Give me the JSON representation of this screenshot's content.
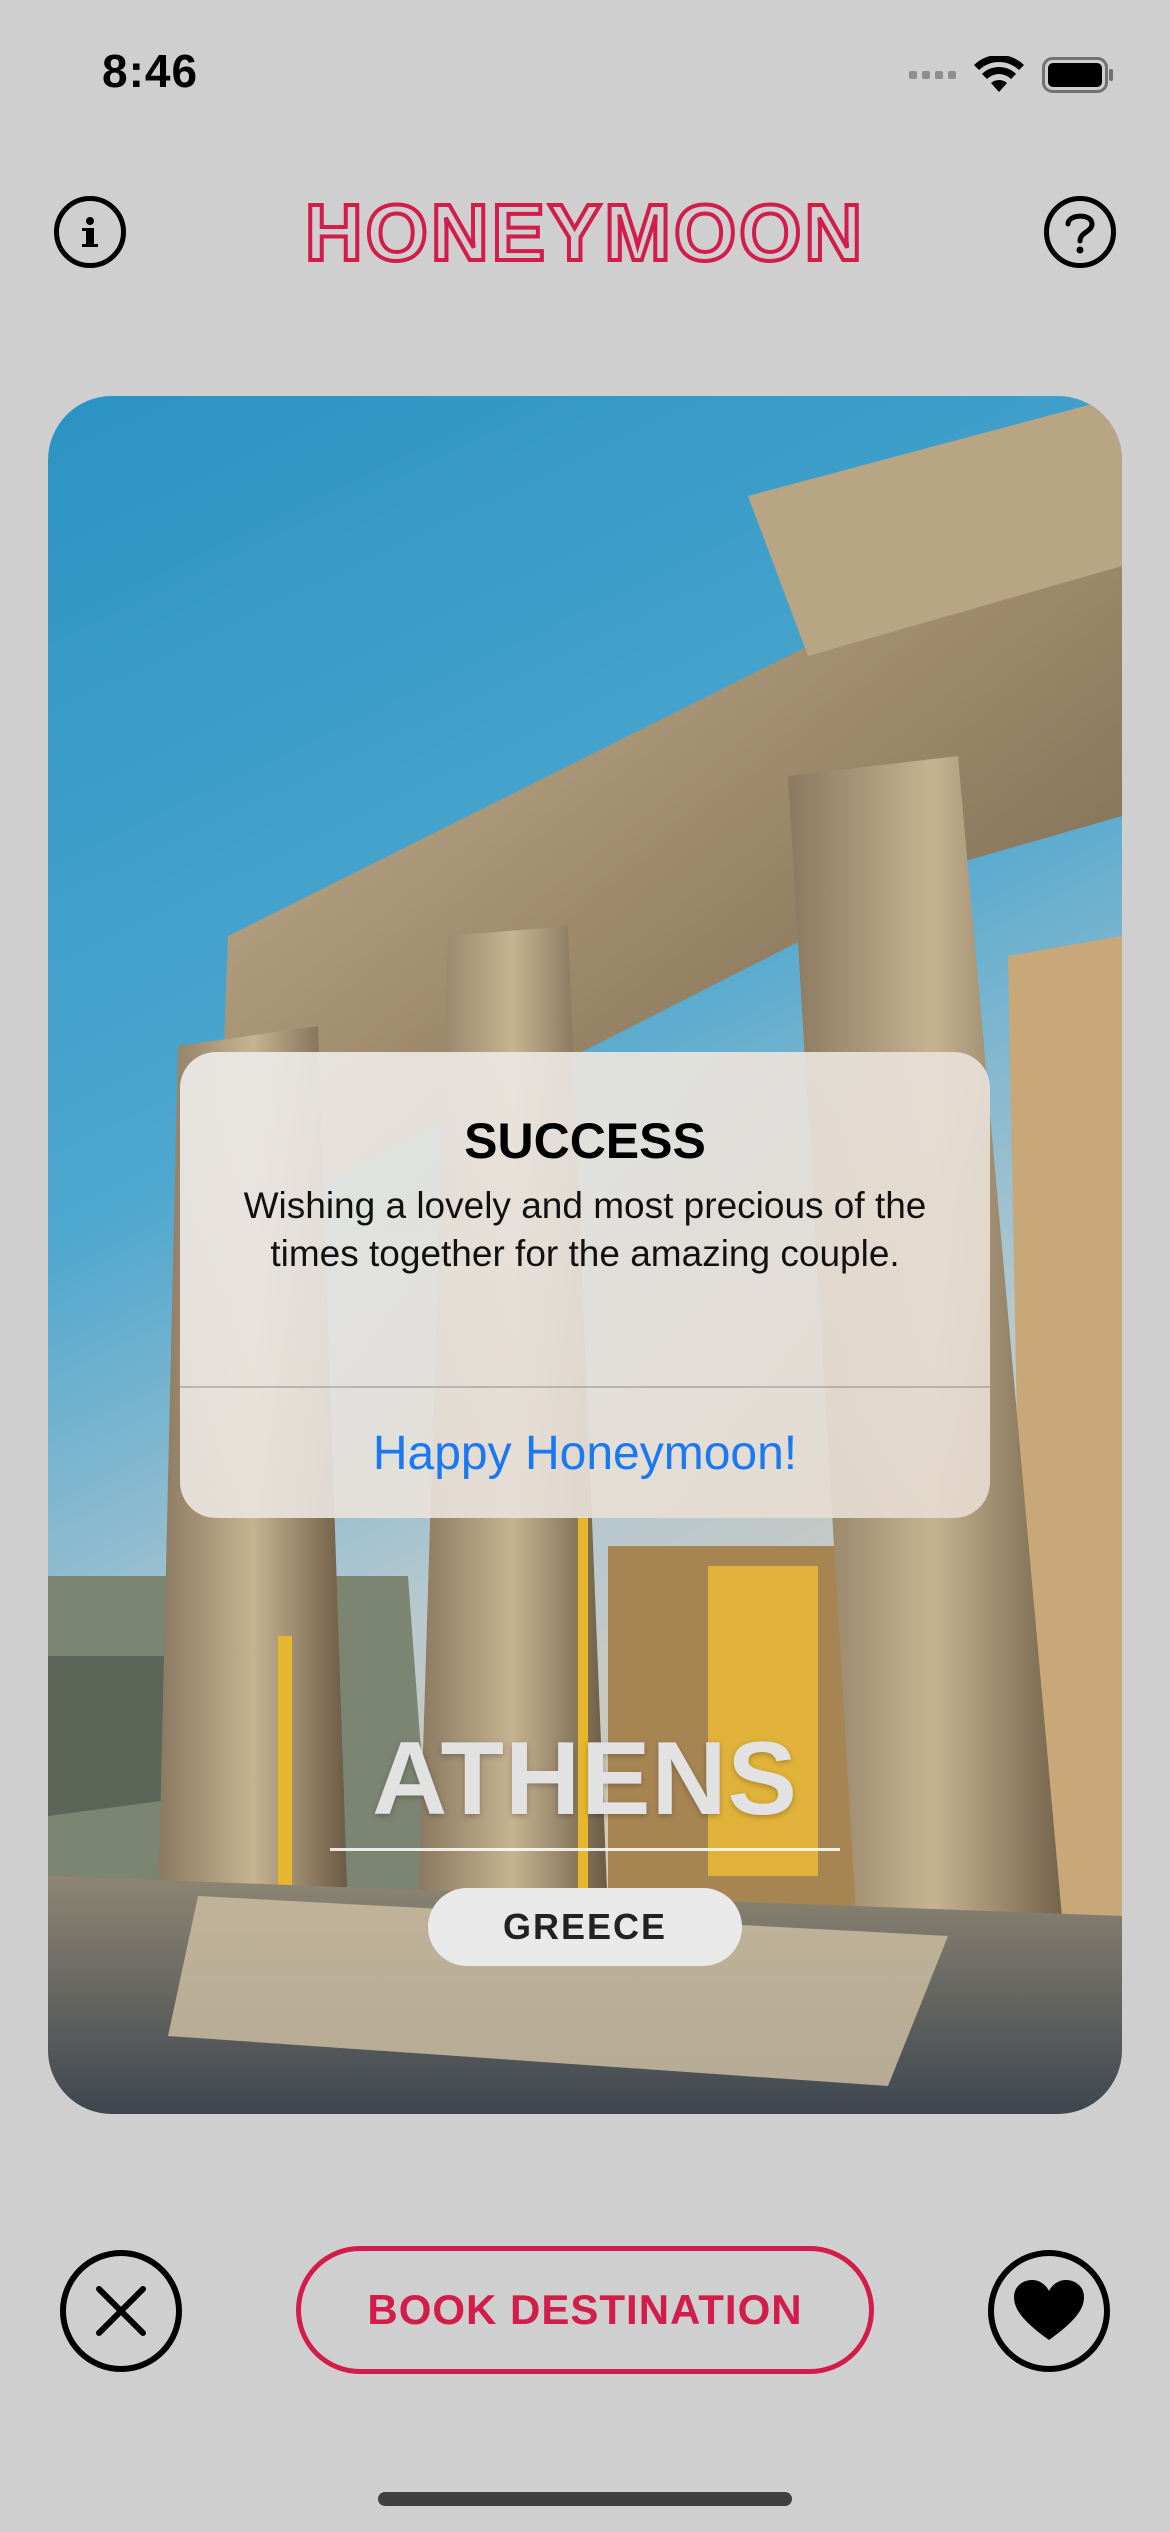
{
  "status_bar": {
    "time": "8:46"
  },
  "header": {
    "logo_text": "HONEYMOON",
    "info_icon": "info-circle-icon",
    "help_icon": "question-circle-icon"
  },
  "card": {
    "city": "ATHENS",
    "country": "GREECE"
  },
  "alert": {
    "title": "SUCCESS",
    "message": "Wishing a lovely and most precious of the times together for the amazing couple.",
    "action_label": "Happy Honeymoon!"
  },
  "bottom_bar": {
    "dismiss_icon": "xmark-circle-icon",
    "book_label": "BOOK DESTINATION",
    "like_icon": "heart-circle-icon"
  },
  "colors": {
    "accent": "#d21c4a",
    "alert_action": "#1a78f0",
    "background": "#cfcfcf"
  }
}
